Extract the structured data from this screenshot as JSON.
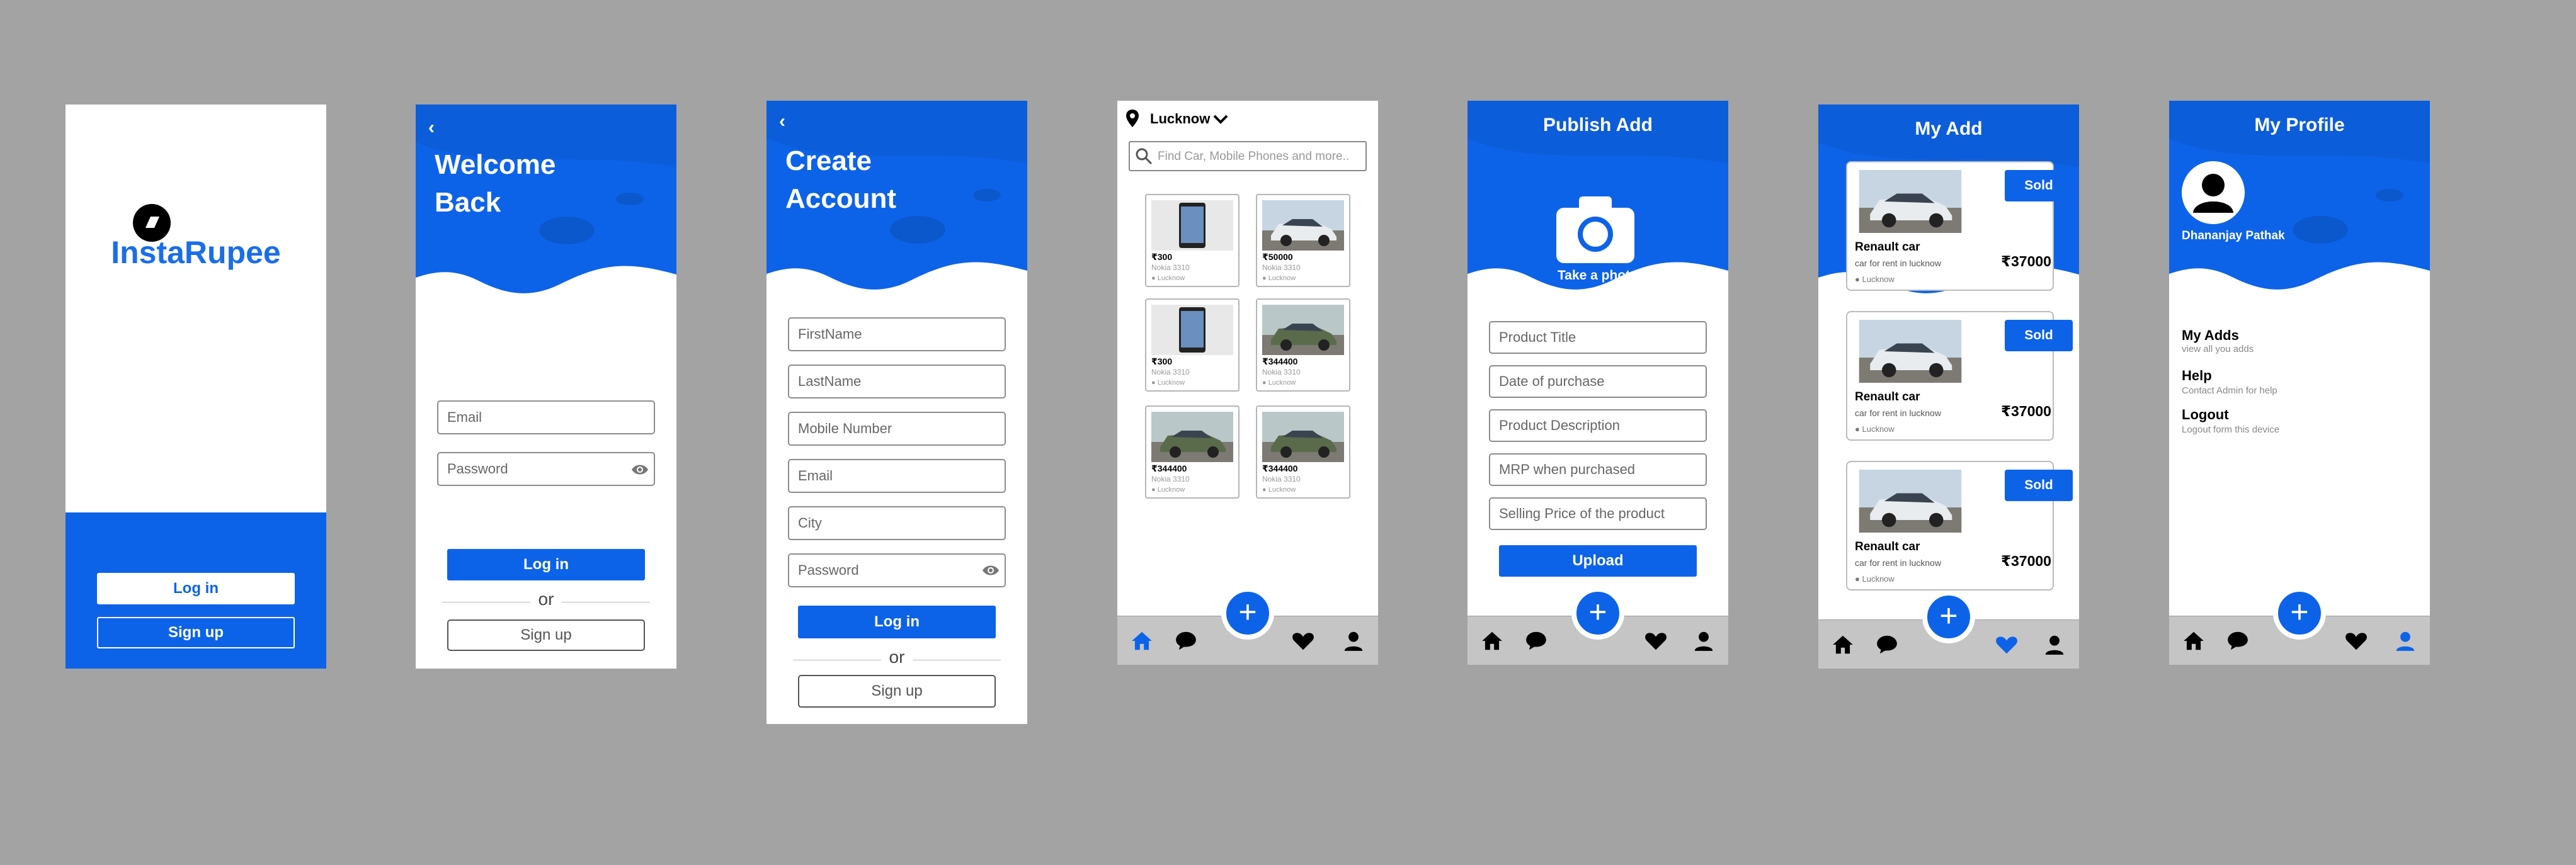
{
  "colors": {
    "primary": "#0d63e8",
    "background": "#a3a3a3",
    "nav": "#c5c5c5"
  },
  "splash": {
    "brand": "InstaRupee",
    "login": "Log in",
    "signup": "Sign up"
  },
  "login": {
    "title_line1": "Welcome",
    "title_line2": "Back",
    "email_placeholder": "Email",
    "password_placeholder": "Password",
    "login": "Log in",
    "or": "or",
    "signup": "Sign up"
  },
  "register": {
    "title_line1": "Create",
    "title_line2": "Account",
    "fields": [
      "FirstName",
      "LastName",
      "Mobile Number",
      "Email",
      "City",
      "Password"
    ],
    "login": "Log in",
    "or": "or",
    "signup": "Sign up"
  },
  "home": {
    "location": "Lucknow",
    "search_placeholder": "Find Car, Mobile Phones and more..",
    "items": [
      {
        "price": "₹300",
        "title": "Nokia 3310",
        "loc": "Lucknow",
        "kind": "phone"
      },
      {
        "price": "₹50000",
        "title": "Nokia 3310",
        "loc": "Lucknow",
        "kind": "car-white"
      },
      {
        "price": "₹300",
        "title": "Nokia 3310",
        "loc": "Lucknow",
        "kind": "phone"
      },
      {
        "price": "₹344400",
        "title": "Nokia 3310",
        "loc": "Lucknow",
        "kind": "car-green"
      },
      {
        "price": "₹344400",
        "title": "Nokia 3310",
        "loc": "Lucknow",
        "kind": "car-green"
      },
      {
        "price": "₹344400",
        "title": "Nokia 3310",
        "loc": "Lucknow",
        "kind": "car-green"
      }
    ]
  },
  "publish": {
    "title": "Publish Add",
    "take_photo": "Take a photo",
    "fields": [
      "Product Title",
      "Date of purchase",
      "Product Description",
      "MRP when purchased",
      "Selling Price of the product"
    ],
    "upload": "Upload"
  },
  "myadd": {
    "title": "My Add",
    "items": [
      {
        "name": "Renault car",
        "desc": "car for rent in lucknow",
        "price": "₹37000",
        "loc": "Lucknow",
        "button": "Sold"
      },
      {
        "name": "Renault car",
        "desc": "car for rent in lucknow",
        "price": "₹37000",
        "loc": "Lucknow",
        "button": "Sold"
      },
      {
        "name": "Renault car",
        "desc": "car for rent in lucknow",
        "price": "₹37000",
        "loc": "Lucknow",
        "button": "Sold"
      }
    ]
  },
  "profile": {
    "title": "My Profile",
    "name": "Dhananjay Pathak",
    "menu": [
      {
        "title": "My Adds",
        "sub": "view all you adds"
      },
      {
        "title": "Help",
        "sub": "Contact Admin for help"
      },
      {
        "title": "Logout",
        "sub": "Logout form this device"
      }
    ]
  },
  "nav_icons": [
    "home-icon",
    "chat-icon",
    "heart-icon",
    "user-icon"
  ]
}
